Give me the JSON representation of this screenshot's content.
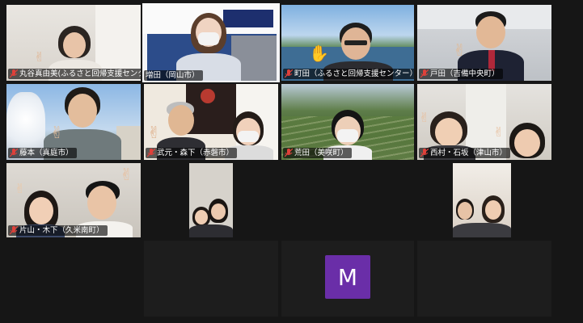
{
  "participants": [
    {
      "name": "丸谷真由美(ふるさと回帰支援センター…",
      "muted": true
    },
    {
      "name": "増田（岡山市）",
      "muted": false,
      "active": true
    },
    {
      "name": "町田（ふるさと回帰支援センター）",
      "muted": true
    },
    {
      "name": "戸田（吉備中央町）",
      "muted": true
    },
    {
      "name": "藤本（真庭市）",
      "muted": true
    },
    {
      "name": "武元・森下（赤磐市）",
      "muted": true
    },
    {
      "name": "荒田（美咲町）",
      "muted": true
    },
    {
      "name": "西村・石坂（津山市）",
      "muted": true
    },
    {
      "name": "片山・木下（久米南町）",
      "muted": true
    }
  ],
  "avatar_initial": "M",
  "colors": {
    "avatar": "#6a2ea8",
    "active_border": "#e8e05a",
    "muted_icon": "#e0403a"
  }
}
